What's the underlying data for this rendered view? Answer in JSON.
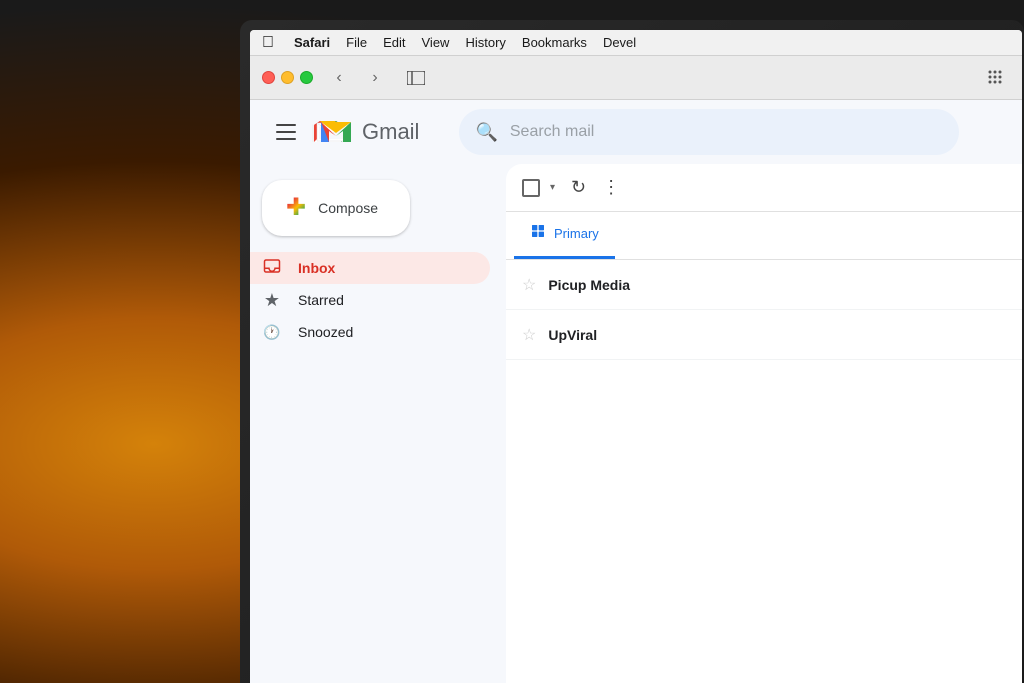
{
  "background": {
    "description": "warm bokeh background with laptop"
  },
  "menubar": {
    "apple_symbol": "",
    "items": [
      {
        "label": "Safari",
        "bold": true
      },
      {
        "label": "File"
      },
      {
        "label": "Edit"
      },
      {
        "label": "View"
      },
      {
        "label": "History"
      },
      {
        "label": "Bookmarks"
      },
      {
        "label": "Devel"
      }
    ]
  },
  "safari_toolbar": {
    "back_label": "‹",
    "forward_label": "›",
    "sidebar_icon": "⬜",
    "grid_icon": "⠿"
  },
  "gmail": {
    "hamburger_label": "menu",
    "logo_text": "Gmail",
    "search_placeholder": "Search mail",
    "compose_label": "Compose",
    "compose_plus": "+",
    "sidebar": {
      "items": [
        {
          "id": "inbox",
          "icon": "📥",
          "label": "Inbox",
          "active": true
        },
        {
          "id": "starred",
          "icon": "★",
          "label": "Starred",
          "active": false
        },
        {
          "id": "snoozed",
          "icon": "🕐",
          "label": "Snoozed",
          "active": false
        }
      ]
    },
    "main_toolbar": {
      "checkbox_title": "select",
      "dropdown_char": "▾",
      "refresh_char": "↻",
      "more_char": "⋮"
    },
    "tabs": [
      {
        "id": "primary",
        "icon": "☰",
        "label": "Primary",
        "active": true
      }
    ],
    "emails": [
      {
        "sender": "Picup Media",
        "subject": "",
        "starred": false
      },
      {
        "sender": "UpViral",
        "subject": "",
        "starred": false
      }
    ]
  }
}
